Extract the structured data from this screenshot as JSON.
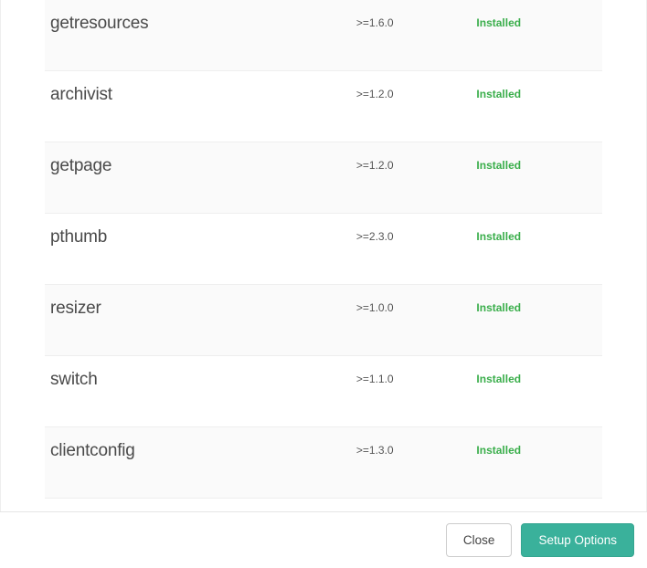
{
  "packages": [
    {
      "name": "getresources",
      "version": ">=1.6.0",
      "status": "Installed"
    },
    {
      "name": "archivist",
      "version": ">=1.2.0",
      "status": "Installed"
    },
    {
      "name": "getpage",
      "version": ">=1.2.0",
      "status": "Installed"
    },
    {
      "name": "pthumb",
      "version": ">=2.3.0",
      "status": "Installed"
    },
    {
      "name": "resizer",
      "version": ">=1.0.0",
      "status": "Installed"
    },
    {
      "name": "switch",
      "version": ">=1.1.0",
      "status": "Installed"
    },
    {
      "name": "clientconfig",
      "version": ">=1.3.0",
      "status": "Installed"
    }
  ],
  "footer": {
    "close_label": "Close",
    "setup_label": "Setup Options"
  }
}
